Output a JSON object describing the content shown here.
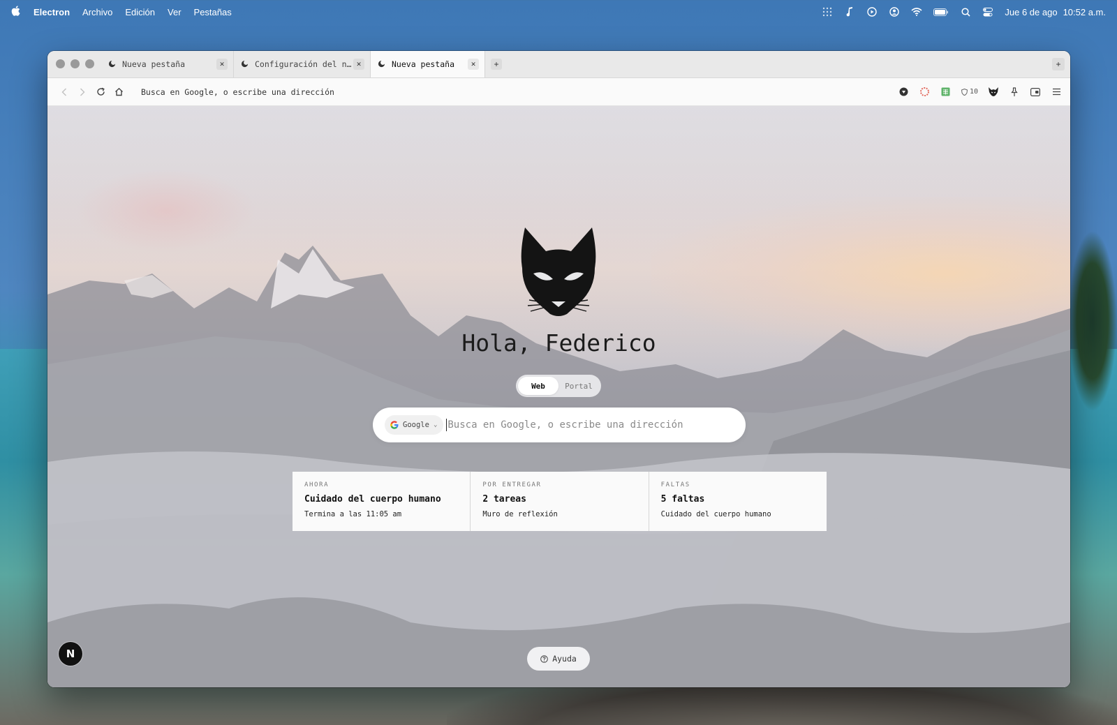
{
  "menubar": {
    "app": "Electron",
    "items": [
      "Archivo",
      "Edición",
      "Ver",
      "Pestañas"
    ],
    "date": "Jue 6 de ago",
    "time": "10:52 a.m.",
    "icons": [
      "launchpad-icon",
      "music-icon",
      "play-icon",
      "user-icon",
      "wifi-icon",
      "battery-icon",
      "spotlight-icon",
      "control-center-icon"
    ]
  },
  "browser": {
    "tabs": [
      {
        "title": "Nueva pestaña",
        "active": false
      },
      {
        "title": "Configuración del n…",
        "active": false
      },
      {
        "title": "Nueva pestaña",
        "active": true
      }
    ],
    "address_placeholder": "Busca en Google, o escribe una dirección",
    "shield_count": "10"
  },
  "newtab": {
    "greeting": "Hola, Federico",
    "segments": [
      "Web",
      "Portal"
    ],
    "active_segment": "Web",
    "engine": "Google",
    "search_placeholder": "Busca en Google, o escribe una dirección",
    "cards": [
      {
        "label": "AHORA",
        "title": "Cuidado del cuerpo humano",
        "sub": "Termina a las 11:05 am"
      },
      {
        "label": "POR ENTREGAR",
        "title": "2 tareas",
        "sub": "Muro de reflexión"
      },
      {
        "label": "FALTAS",
        "title": "5 faltas",
        "sub": "Cuidado del cuerpo humano"
      }
    ],
    "help_label": "Ayuda",
    "badge_letter": "N"
  },
  "colors": {
    "accent": "#111111",
    "google_blue": "#4285F4"
  }
}
